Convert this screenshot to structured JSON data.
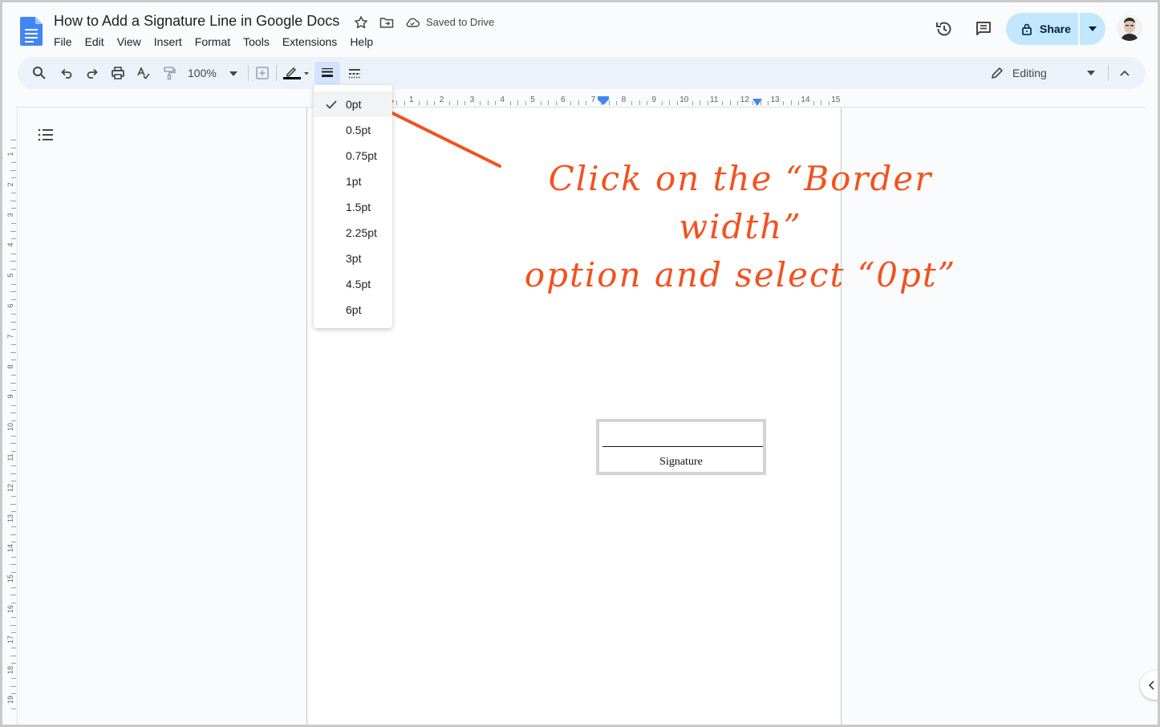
{
  "document": {
    "title": "How to Add a Signature Line in Google Docs",
    "save_status": "Saved to Drive"
  },
  "menu": [
    "File",
    "Edit",
    "View",
    "Insert",
    "Format",
    "Tools",
    "Extensions",
    "Help"
  ],
  "header": {
    "share_label": "Share"
  },
  "toolbar": {
    "zoom": "100%",
    "mode_label": "Editing"
  },
  "ruler": {
    "horizontal": [
      "1",
      "2",
      "3",
      "4",
      "5",
      "6",
      "7",
      "8",
      "9",
      "10",
      "11",
      "12",
      "13",
      "14",
      "15"
    ],
    "vertical": [
      "1",
      "2",
      "3",
      "4",
      "5",
      "6",
      "7",
      "8",
      "9",
      "10",
      "11",
      "12",
      "13",
      "14",
      "15",
      "16",
      "17",
      "18",
      "19"
    ]
  },
  "border_width_menu": {
    "options": [
      "0pt",
      "0.5pt",
      "0.75pt",
      "1pt",
      "1.5pt",
      "2.25pt",
      "3pt",
      "4.5pt",
      "6pt"
    ],
    "selected": "0pt"
  },
  "document_body": {
    "signature_label": "Signature"
  },
  "annotation": {
    "line1": "Click on the “Border width”",
    "line2": "option and select “0pt”"
  },
  "colors": {
    "accent": "#f4511e",
    "share_bg": "#c2e7ff",
    "toolbar_bg": "#edf2fa",
    "docs_blue": "#4285f4"
  }
}
